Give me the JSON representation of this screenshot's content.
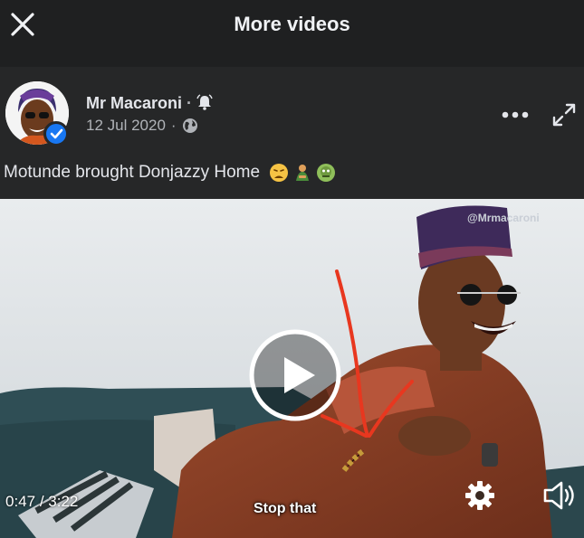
{
  "topbar": {
    "title": "More videos",
    "close_icon": "close-icon"
  },
  "post": {
    "author": "Mr Macaroni",
    "author_separator": "·",
    "notification_icon": "bell-icon",
    "date": "12 Jul 2020",
    "date_separator": "·",
    "privacy_icon": "globe-icon",
    "verified_icon": "verified-badge-icon",
    "more_icon": "more-options-icon",
    "expand_icon": "expand-icon",
    "caption": "Motunde brought Donjazzy Home",
    "caption_emojis": [
      "weary-face-emoji",
      "person-bowing-emoji",
      "zombie-emoji"
    ]
  },
  "video": {
    "watermark": "@Mrmacaroni",
    "time_current": "0:47",
    "time_separator": "/",
    "time_total": "3:22",
    "subtitle": "Stop that",
    "play_icon": "play-icon",
    "settings_icon": "settings-gear-icon",
    "volume_icon": "volume-icon"
  },
  "colors": {
    "topbar_bg": "#1f2021",
    "post_bg": "#262728",
    "text_primary": "#e4e6eb",
    "text_secondary": "#b0b3b8",
    "verified_blue": "#1877f2",
    "annotation_red": "#e8371f"
  }
}
